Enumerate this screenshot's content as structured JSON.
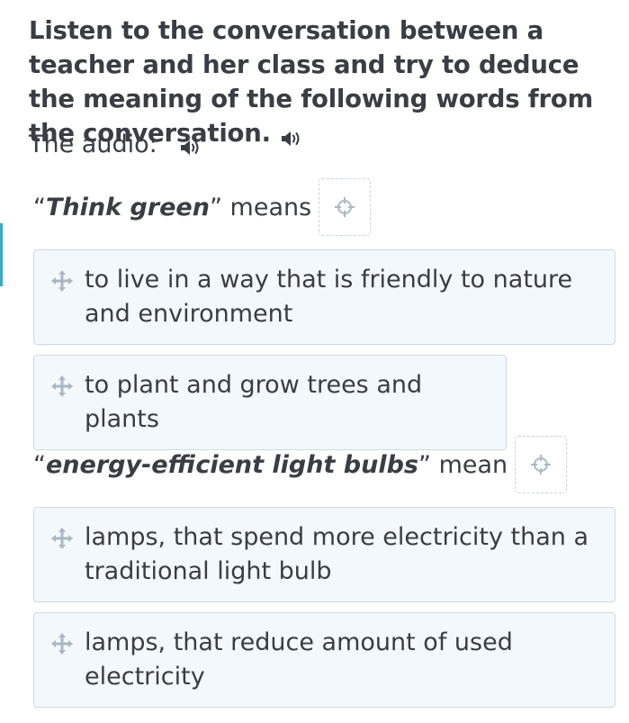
{
  "instruction": {
    "text": "Listen to the conversation between a teacher and her class and try to deduce the meaning of the following words from the conversation.",
    "icon": "speaker-icon"
  },
  "audio": {
    "label": "The audio:",
    "icon": "speaker-icon"
  },
  "questions": [
    {
      "open_quote": "“",
      "term": "Think green",
      "close_quote": "”",
      "verb": " means",
      "options": [
        "to live in a way that is friendly to nature and environment",
        "to plant and grow trees and plants"
      ]
    },
    {
      "open_quote": "“",
      "term": "energy-efficient light bulbs",
      "close_quote": "”",
      "verb": " mean",
      "options": [
        "lamps, that spend more electricity than a traditional light bulb",
        "lamps, that reduce amount of used electricity"
      ]
    }
  ],
  "colors": {
    "text": "#3a3d44",
    "option_bg": "#f3f8fc",
    "option_border": "#cdd9e1",
    "icon": "#a8b8c4",
    "accent": "#3aa8c6"
  }
}
